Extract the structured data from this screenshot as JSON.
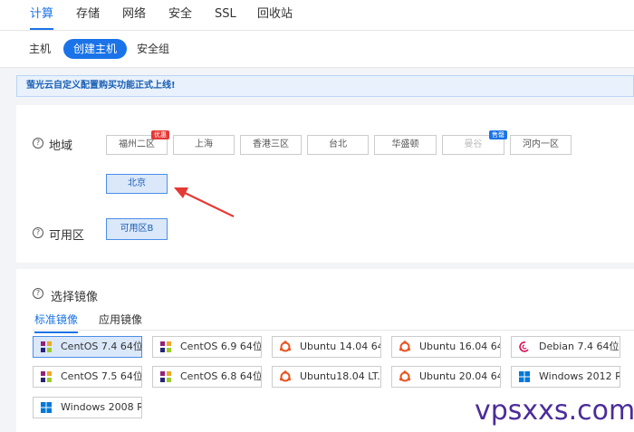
{
  "top_tabs": [
    "计算",
    "存储",
    "网络",
    "安全",
    "SSL",
    "回收站"
  ],
  "sub_tabs": [
    "主机",
    "创建主机",
    "安全组"
  ],
  "notice": "萤光云自定义配置购买功能正式上线!",
  "region": {
    "label": "地域",
    "options": [
      "福州二区",
      "上海",
      "香港三区",
      "台北",
      "华盛顿",
      "曼谷",
      "河内一区",
      "北京"
    ],
    "tag_hot": "优惠",
    "tag_sold": "售罄"
  },
  "zone": {
    "label": "可用区",
    "option": "可用区B"
  },
  "image": {
    "label": "选择镜像",
    "tabs": [
      "标准镜像",
      "应用镜像"
    ],
    "items": [
      {
        "name": "CentOS 7.4 64位",
        "icon": "centos-icon"
      },
      {
        "name": "CentOS 6.9 64位",
        "icon": "centos-icon"
      },
      {
        "name": "Ubuntu 14.04 64...",
        "icon": "ubuntu-icon"
      },
      {
        "name": "Ubuntu 16.04 64...",
        "icon": "ubuntu-icon"
      },
      {
        "name": "Debian 7.4 64位",
        "icon": "debian-icon"
      },
      {
        "name": "CentOS 7.5 64位",
        "icon": "centos-icon"
      },
      {
        "name": "CentOS 6.8 64位",
        "icon": "centos-icon"
      },
      {
        "name": "Ubuntu18.04 LT...",
        "icon": "ubuntu-icon"
      },
      {
        "name": "Ubuntu 20.04 64...",
        "icon": "ubuntu-icon"
      },
      {
        "name": "Windows 2012 R...",
        "icon": "windows-icon"
      },
      {
        "name": "Windows 2008 R...",
        "icon": "windows-icon"
      }
    ]
  },
  "help_glyph": "?",
  "watermark": "vpsxxs.com",
  "colors": {
    "accent": "#1a73e8",
    "hot": "#e53935"
  }
}
